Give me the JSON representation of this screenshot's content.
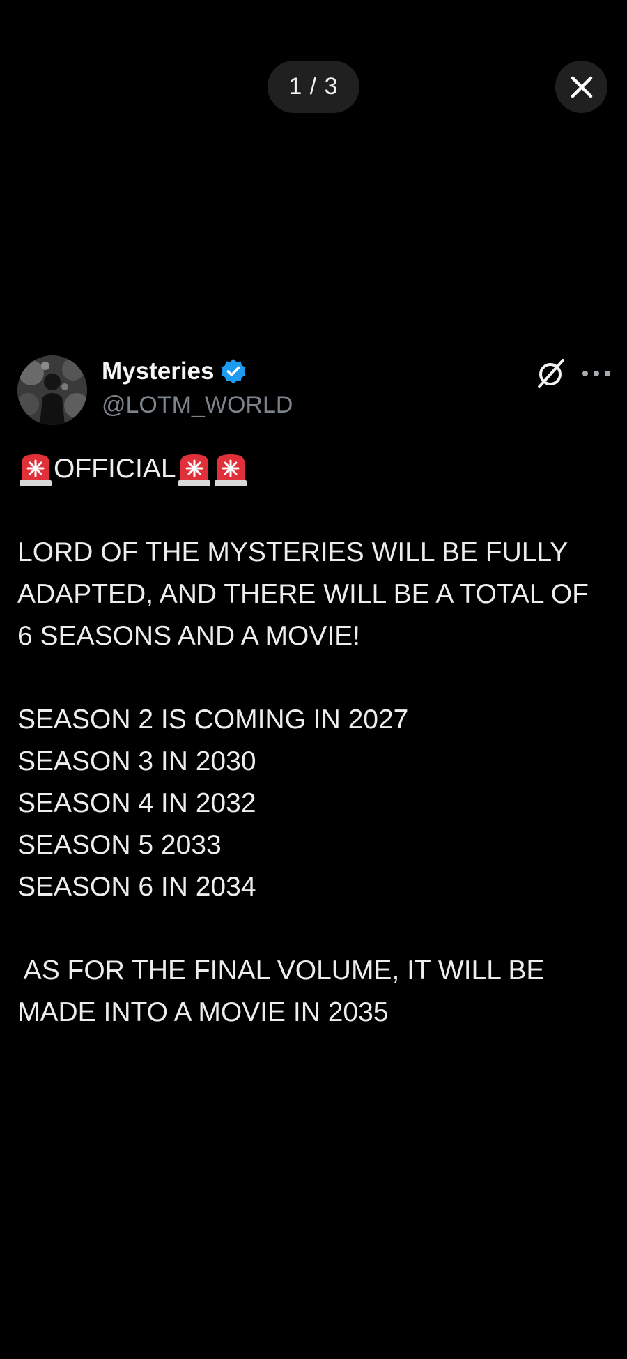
{
  "viewer": {
    "counter": "1 / 3",
    "close_icon": "close-icon"
  },
  "post": {
    "author": {
      "display_name": "Mysteries",
      "handle": "@LOTM_WORLD",
      "verified_icon": "verified-badge-icon",
      "verified_color": "#1d9bf0"
    },
    "actions": {
      "grok_icon": "grok-icon",
      "more_icon": "more-options-icon"
    },
    "body": {
      "official_label": "OFFICIAL",
      "siren_icon": "police-siren-emoji",
      "paragraph_1": [
        "LORD OF THE MYSTERIES WILL BE FULLY",
        "ADAPTED, AND THERE WILL BE A TOTAL OF",
        "6 SEASONS AND A MOVIE!"
      ],
      "paragraph_2": [
        "SEASON 2 IS COMING IN 2027",
        "SEASON 3 IN 2030",
        "SEASON 4 IN 2032",
        "SEASON 5 2033",
        "SEASON 6 IN 2034"
      ],
      "paragraph_3": [
        " AS FOR THE FINAL VOLUME, IT WILL BE",
        "MADE INTO A MOVIE IN 2035"
      ]
    }
  },
  "colors": {
    "background": "#000000",
    "pill": "#202020",
    "text": "#ededed",
    "handle": "#7c838a"
  }
}
